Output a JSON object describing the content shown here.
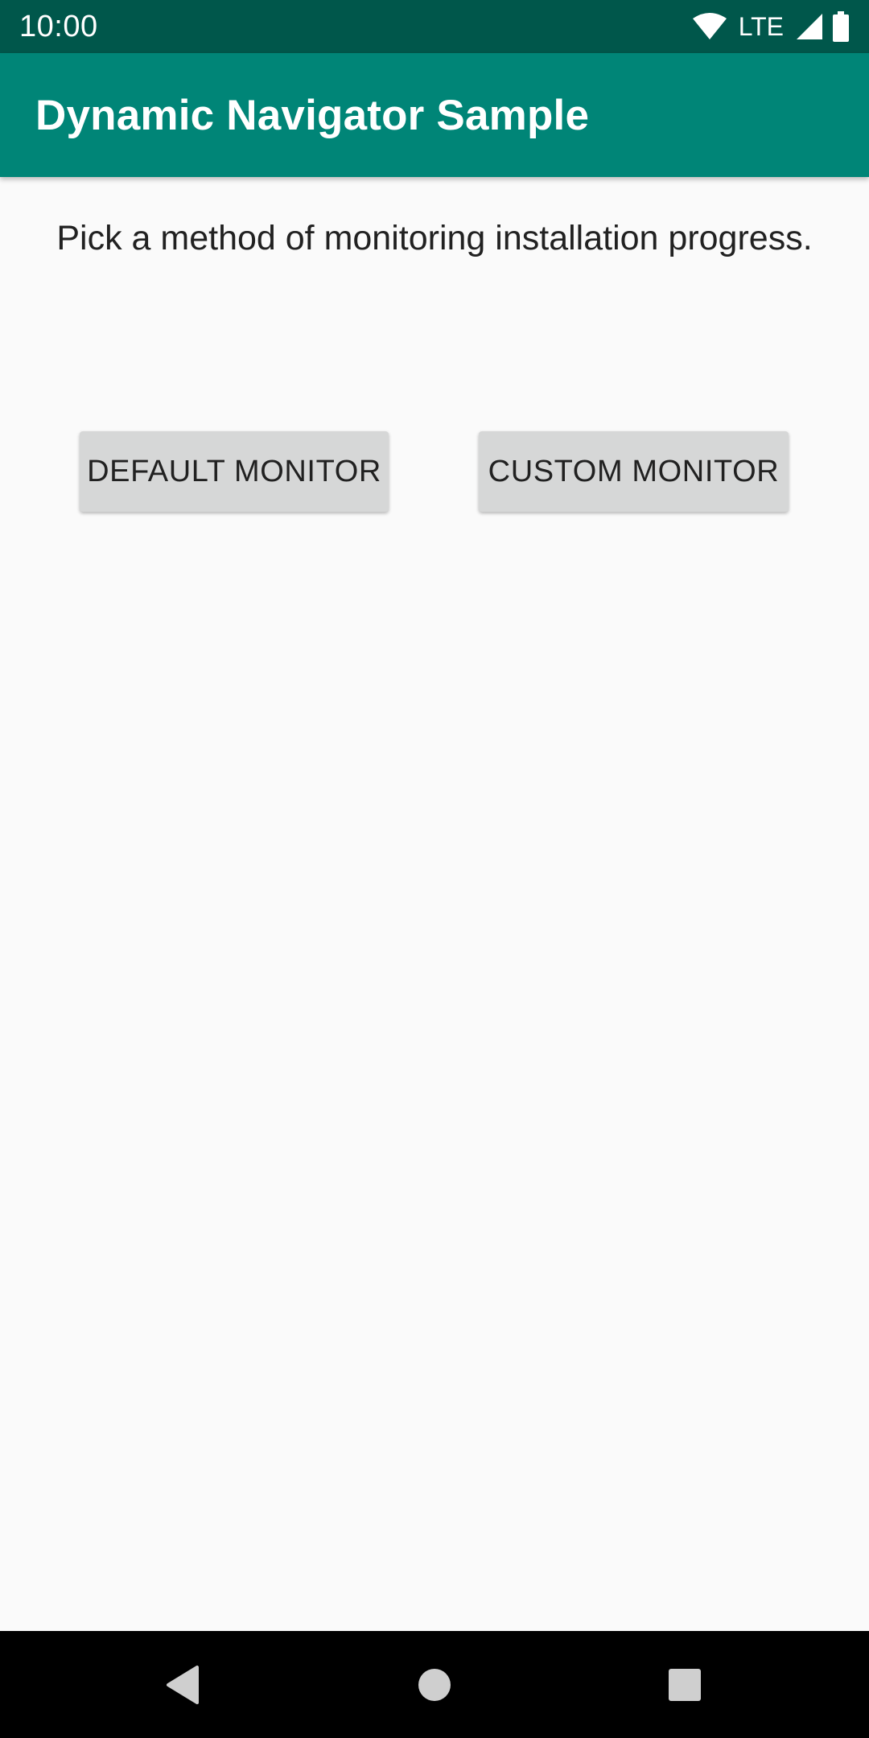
{
  "status_bar": {
    "time": "10:00",
    "network": "LTE",
    "icons": [
      "wifi-icon",
      "signal-icon",
      "battery-icon"
    ]
  },
  "app_bar": {
    "title": "Dynamic Navigator Sample"
  },
  "main": {
    "instruction": "Pick a method of monitoring installation progress.",
    "buttons": {
      "default_monitor": "DEFAULT MONITOR",
      "custom_monitor": "CUSTOM MONITOR"
    }
  },
  "nav_bar": {
    "items": [
      "back-icon",
      "home-icon",
      "recents-icon"
    ]
  },
  "colors": {
    "status_bar": "#00574b",
    "app_bar": "#008577",
    "background": "#fafafa",
    "button": "#d6d7d7",
    "text": "#212121",
    "nav_bar": "#000000"
  }
}
